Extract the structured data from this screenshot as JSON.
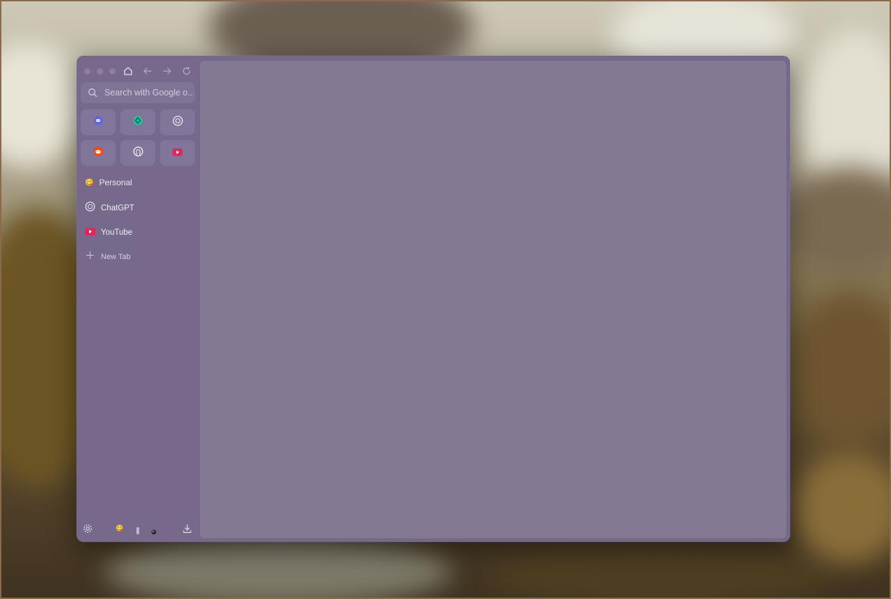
{
  "colors": {
    "window_bg": "#76698c",
    "content_bg": "#847993",
    "discord": "#5865F2",
    "perplexity": "#20c2a0",
    "reddit": "#ff4500",
    "youtube": "#e8235a"
  },
  "toolbar": {
    "home_icon": "home-icon",
    "back_icon": "arrow-left-icon",
    "forward_icon": "arrow-right-icon",
    "reload_icon": "reload-icon"
  },
  "search": {
    "placeholder": "Search with Google o..."
  },
  "pinned": [
    {
      "name": "Discord",
      "icon": "discord-icon"
    },
    {
      "name": "Perplexity",
      "icon": "perplexity-icon"
    },
    {
      "name": "ChatGPT",
      "icon": "openai-icon"
    },
    {
      "name": "Reddit",
      "icon": "reddit-icon"
    },
    {
      "name": "GitHub",
      "icon": "github-icon"
    },
    {
      "name": "YouTube",
      "icon": "youtube-icon"
    }
  ],
  "space": {
    "emoji": "😋",
    "label": "Personal"
  },
  "tabs": [
    {
      "label": "ChatGPT",
      "icon": "openai-icon"
    },
    {
      "label": "YouTube",
      "icon": "youtube-icon"
    }
  ],
  "new_tab": {
    "label": "New Tab",
    "icon": "plus-icon"
  },
  "footer": {
    "settings_icon": "settings-icon",
    "space_emoji": "😋",
    "download_icon": "download-icon"
  }
}
